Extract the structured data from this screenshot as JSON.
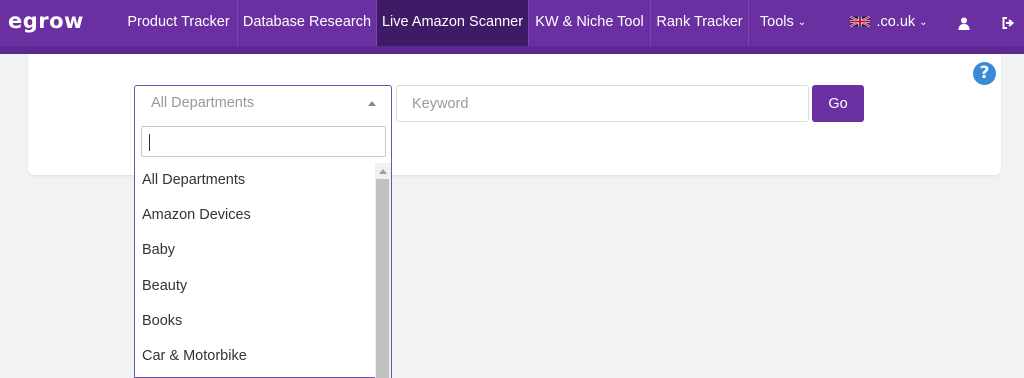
{
  "logo": {
    "text": "egrow"
  },
  "nav": {
    "items": [
      {
        "label": "Product Tracker"
      },
      {
        "label": "Database Research"
      },
      {
        "label": "Live Amazon Scanner"
      },
      {
        "label": "KW & Niche Tool"
      },
      {
        "label": "Rank Tracker"
      },
      {
        "label": "Tools"
      }
    ],
    "marketplace": ".co.uk",
    "active_index": 2
  },
  "search": {
    "department_value": "All Departments",
    "keyword_placeholder": "Keyword",
    "go_label": "Go"
  },
  "help_icon": "?",
  "dropdown": {
    "search_value": "",
    "options": [
      {
        "label": "All Departments"
      },
      {
        "label": "Amazon Devices"
      },
      {
        "label": "Baby"
      },
      {
        "label": "Beauty"
      },
      {
        "label": "Books"
      },
      {
        "label": "Car & Motorbike"
      }
    ]
  },
  "colors": {
    "brand": "#6a2fa0",
    "nav_active": "#3f1a66",
    "help": "#3a8ad6"
  }
}
